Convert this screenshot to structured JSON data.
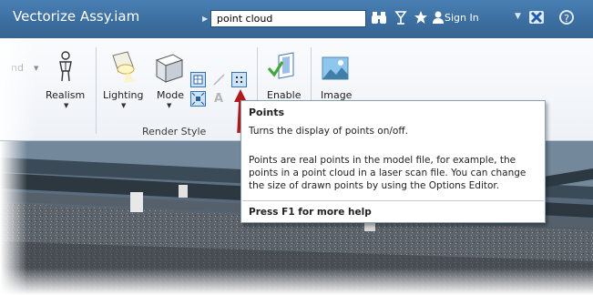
{
  "window": {
    "title": "Vectorize Assy.iam"
  },
  "search": {
    "value": "point cloud"
  },
  "title_bar": {
    "sign_in_label": "Sign In",
    "icons": [
      "binoculars-icon",
      "antenna-icon",
      "star-icon",
      "user-icon",
      "dropdown-icon",
      "exchange-x-icon",
      "help-icon"
    ]
  },
  "ribbon": {
    "partial_label": "nd",
    "realism_label": "Realism",
    "lighting_label": "Lighting",
    "mode_label": "Mode",
    "enable_label": "Enable",
    "image_label": "Image",
    "group_label": "Render Style"
  },
  "tooltip": {
    "title": "Points",
    "subtitle": "Turns the display of points on/off.",
    "body": "Points are real points in the model file, for example, the points in a point cloud in a laser scan file. You can change the size of drawn points by using the Options Editor.",
    "footer": "Press F1 for more help"
  },
  "colors": {
    "title_bar": "#3d71a3",
    "ribbon_bg": "#f5f7fa",
    "button_highlight": "#2f74c0",
    "annotation_arrow": "#b01c1c"
  }
}
